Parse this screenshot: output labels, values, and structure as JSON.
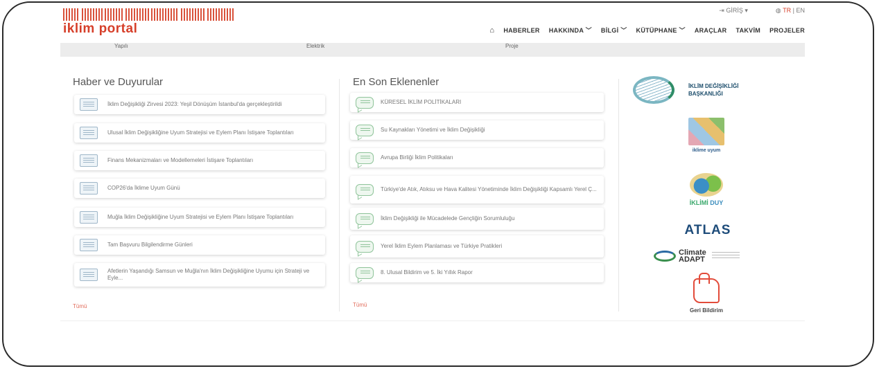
{
  "header": {
    "logo_text": "iklim portal",
    "login_label": "GİRİŞ",
    "lang_tr": "TR",
    "lang_sep": "|",
    "lang_en": "EN"
  },
  "nav": {
    "items": [
      "HABERLER",
      "HAKKINDA ﹀",
      "BİLGİ ﹀",
      "KÜTÜPHANE ﹀",
      "ARAÇLAR",
      "TAKVİM",
      "PROJELER"
    ]
  },
  "subbar": {
    "items": [
      "Yapılı",
      "Elektrik",
      "Proje"
    ]
  },
  "news": {
    "title": "Haber ve Duyurular",
    "items": [
      "İklim Değişikliği Zirvesi 2023: Yeşil Dönüşüm İstanbul'da gerçekleştirildi",
      "Ulusal İklim Değişikliğine Uyum Stratejisi ve Eylem Planı İstişare Toplantıları",
      "Finans Mekanizmaları ve Modellemeleri İstişare Toplantıları",
      "COP26'da İklime Uyum Günü",
      "Muğla İklim Değişikliğine Uyum Stratejisi ve Eylem Planı İstişare Toplantıları",
      "Tam Başvuru Bilgilendirme Günleri",
      "Afetlerin Yaşandığı Samsun ve Muğla'nın İklim Değişikliğine Uyumu için Strateji ve Eyle..."
    ],
    "more": "Tümü"
  },
  "latest": {
    "title": "En Son Eklenenler",
    "items": [
      "KÜRESEL İKLİM POLİTİKALARI",
      "Su Kaynakları Yönetimi ve İklim Değişikliği",
      "Avrupa Birliği İklim Politikaları",
      "Türkiye'de Atık, Atıksu ve Hava Kalitesi Yönetiminde İklim Değişikliği Kapsamlı Yerel Ç...",
      "İklim Değişikliği ile Mücadelede Gençliğin Sorumluluğu",
      "Yerel İklim Eylem Planlaması ve Türkiye Pratikleri",
      "8. Ulusal Bildirim ve 5. İki Yıllık Rapor"
    ],
    "more": "Tümü"
  },
  "partners": {
    "iklim_line1": "İKLİM DEĞİŞİKLİĞİ",
    "iklim_line2": "BAŞKANLIĞI",
    "uyum_label": "iklime uyum",
    "duy_word1": "İKLİMİ",
    "duy_word2": "DUY",
    "atlas_label": "ATLAS",
    "climate_line1": "Climate",
    "climate_line2": "ADAPT",
    "geri_label": "Geri Bildirim"
  },
  "colors": {
    "brand_red": "#d63f2a",
    "link_red": "#e26d5c"
  }
}
